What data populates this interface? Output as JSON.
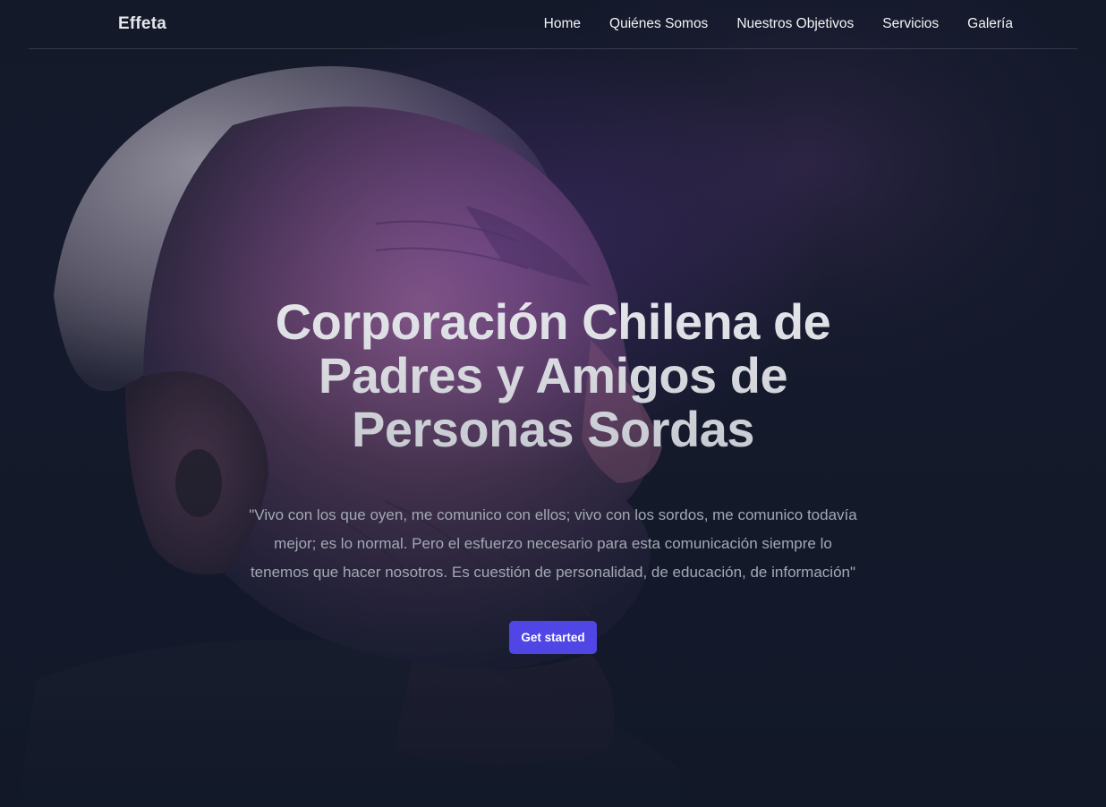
{
  "nav": {
    "brand": "Effeta",
    "links": [
      {
        "label": "Home"
      },
      {
        "label": "Quiénes Somos"
      },
      {
        "label": "Nuestros Objetivos"
      },
      {
        "label": "Servicios"
      },
      {
        "label": "Galería"
      }
    ]
  },
  "hero": {
    "title": "Corporación Chilena de Padres y Amigos de Personas Sordas",
    "quote": "\"Vivo con los que oyen, me comunico con ellos; vivo con los sordos, me comunico todavía mejor; es lo normal. Pero el esfuerzo necesario para esta comunicación siempre lo tenemos que hacer nosotros. Es cuestión de personalidad, de educación, de información\"",
    "cta_label": "Get started",
    "background_image": "elderly-man-profile-with-hearing-aid"
  },
  "colors": {
    "background": "#111827",
    "accent": "#4f46e5",
    "title_text": "#e5e7eb",
    "quote_text": "#a3a8b4"
  }
}
